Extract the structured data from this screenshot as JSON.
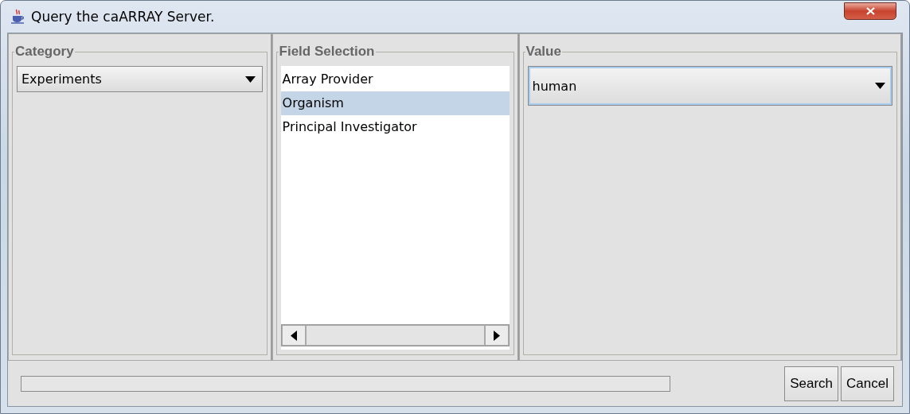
{
  "window": {
    "title": "Query the caARRAY Server."
  },
  "category": {
    "title": "Category",
    "value": "Experiments"
  },
  "field_selection": {
    "title": "Field Selection",
    "items": [
      {
        "label": "Array Provider",
        "selected": false
      },
      {
        "label": "Organism",
        "selected": true
      },
      {
        "label": "Principal Investigator",
        "selected": false
      }
    ]
  },
  "value": {
    "title": "Value",
    "value": "human",
    "focused": true
  },
  "progress": {
    "level": 0
  },
  "buttons": [
    "Search",
    "Cancel"
  ]
}
